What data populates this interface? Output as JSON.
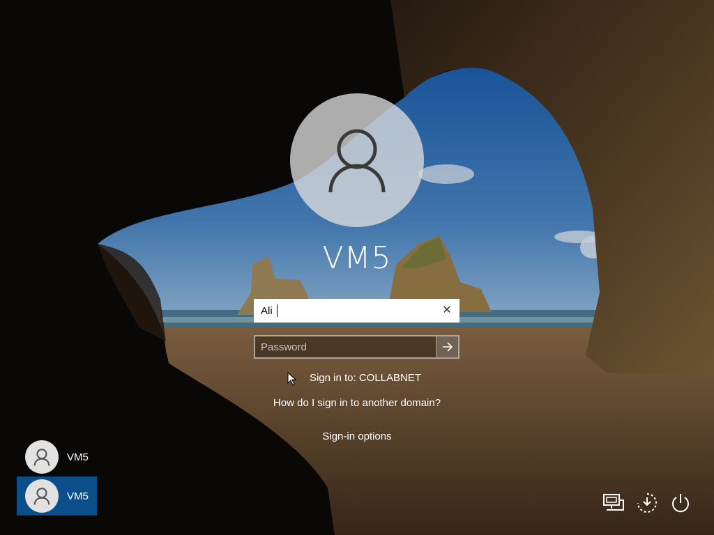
{
  "account": {
    "display_name": "VM5"
  },
  "username_field": {
    "value": "Ali"
  },
  "password_field": {
    "placeholder": "Password"
  },
  "sign_in_to": "Sign in to: COLLABNET",
  "other_domain_link": "How do I sign in to another domain?",
  "sign_in_options_link": "Sign-in options",
  "user_list": [
    {
      "name": "VM5",
      "selected": false
    },
    {
      "name": "VM5",
      "selected": true
    }
  ],
  "colors": {
    "selected_tile": "#0b4f8a"
  },
  "system_icons": [
    "network-icon",
    "ease-of-access-icon",
    "power-icon"
  ]
}
